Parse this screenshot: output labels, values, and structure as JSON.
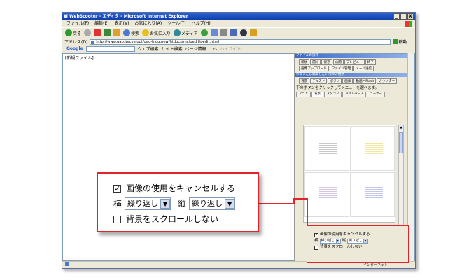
{
  "window": {
    "title": "WebScooter - エディタ - Microsoft Internet Explorer",
    "min": "_",
    "max": "□",
    "close": "X"
  },
  "menu": [
    "ファイル(F)",
    "編集(E)",
    "表示(V)",
    "お気に入り(A)",
    "ツール(T)",
    "ヘルプ(H)"
  ],
  "toolbar": {
    "back": "戻る",
    "search": "検索",
    "favorites": "お気に入り",
    "media": "メディア"
  },
  "address": {
    "label": "アドレス(D)",
    "url": "http://www.gao.jp/cvsroot/gao-blog.new/htdocs/mc/pedit/pedit.html",
    "go": "移動"
  },
  "google": {
    "logo": "Google",
    "web_search": "ウェブ検索",
    "site_search": "サイト検索",
    "page_info": "ページ情報",
    "up": "上へ",
    "highlight": "ハイライト"
  },
  "content_label": "[新規ファイル]",
  "panel": {
    "file_ops_title": "ファイルの操作",
    "file_buttons": [
      "新規",
      "開く",
      "保存",
      "公開",
      "プレビュー",
      "終了"
    ],
    "file_buttons_2": [
      "画像アップロード",
      "ファイル管理",
      "メール送信"
    ],
    "edit_title": "作成または編集したい項目の選択",
    "edit_buttons": [
      "背景",
      "テキスト",
      "ボタン",
      "画像",
      "動画・Flash"
    ],
    "edit_buttons_2": [
      "カウンター"
    ],
    "hint": "下のボタンをクリックしてメニューを選べます。",
    "tabs": [
      "アニメ",
      "背景",
      "スタンプ",
      "タイルベース",
      "ユーザー"
    ]
  },
  "status": {
    "zone": "インターネット"
  },
  "options": {
    "cancel_image": "画像の使用をキャンセルする",
    "horizontal": "横",
    "vertical": "縦",
    "repeat": "繰り返し",
    "no_scroll": "背景をスクロールしない",
    "checked_mark": "✓"
  },
  "thumb_colors": [
    "#c8c8c8",
    "#f2e6a0",
    "#d8c6e0",
    "#c2c6e8"
  ],
  "accent": "#e0242a"
}
